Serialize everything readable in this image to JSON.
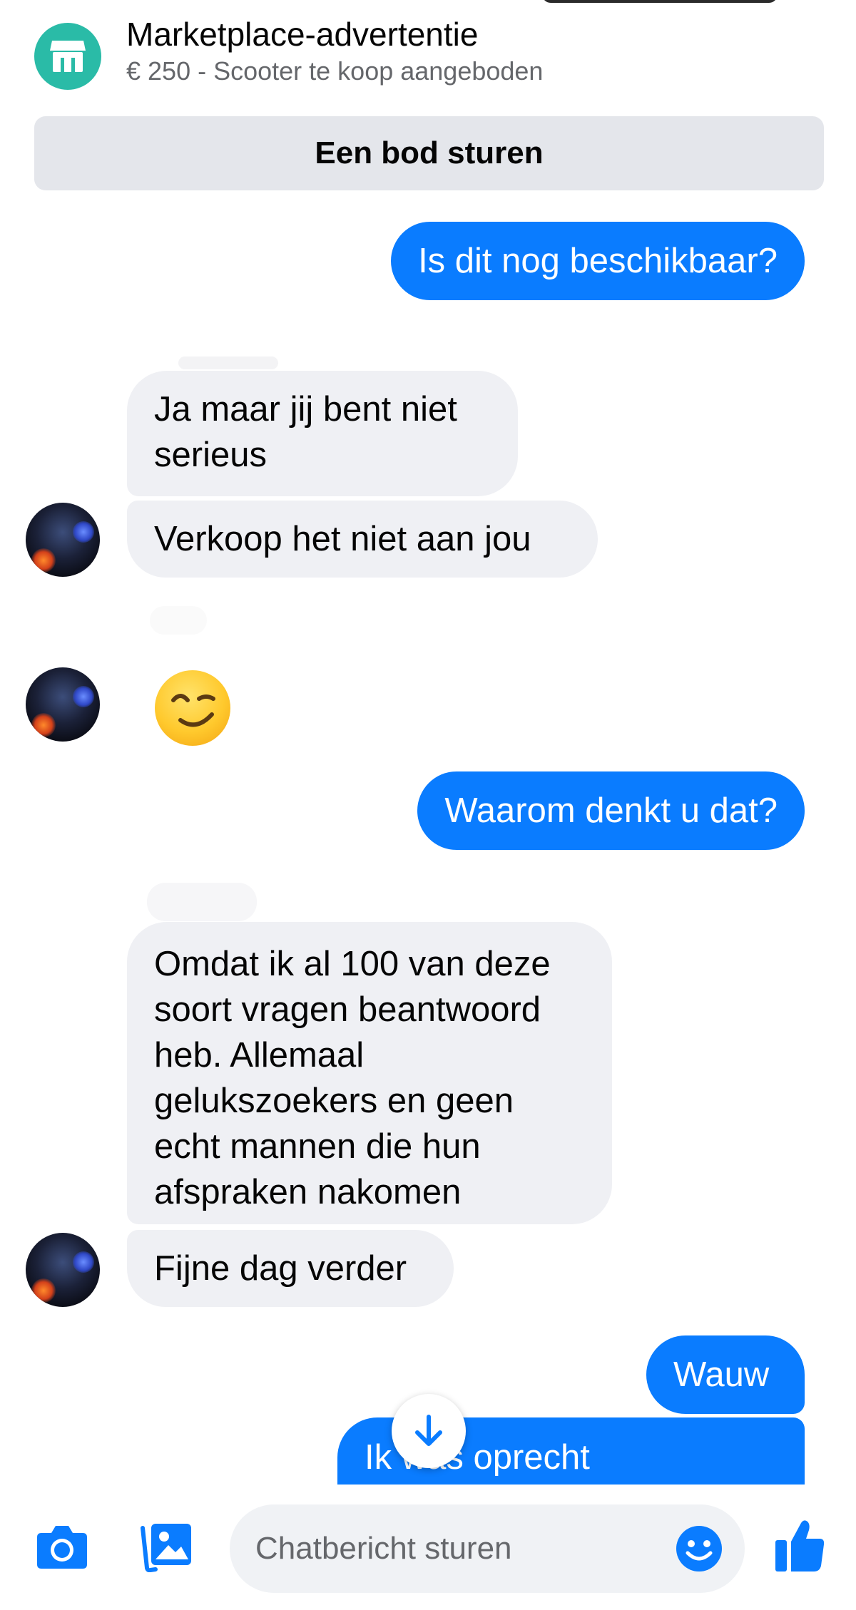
{
  "listing": {
    "title": "Marketplace-advertentie",
    "subtitle": "€ 250 - Scooter te koop aangeboden",
    "offer_button": "Een bod sturen"
  },
  "messages": [
    {
      "from": "me",
      "text": "Is dit nog beschikbaar?"
    },
    {
      "from": "seller",
      "text": "Ja maar jij bent niet\nserieus"
    },
    {
      "from": "seller",
      "text": "Verkoop het niet aan jou"
    },
    {
      "from": "seller",
      "text": "😉",
      "type": "emoji"
    },
    {
      "from": "me",
      "text": "Waarom denkt u dat?"
    },
    {
      "from": "seller",
      "text": "Omdat ik al 100 van deze\nsoort vragen beantwoord\nheb. Allemaal\ngelukszoekers en geen\necht mannen die hun\nafspraken nakomen"
    },
    {
      "from": "seller",
      "text": "Fijne dag verder"
    },
    {
      "from": "me",
      "text": "Wauw"
    },
    {
      "from": "me",
      "text": "Ik was oprecht"
    }
  ],
  "composer": {
    "placeholder": "Chatbericht sturen"
  },
  "icons": {
    "store": "store-icon",
    "camera": "camera-icon",
    "gallery": "gallery-icon",
    "emoji": "emoji-icon",
    "like": "thumbs-up-icon",
    "scroll": "arrow-down-icon"
  },
  "colors": {
    "outgoing_bubble": "#0a7cff",
    "incoming_bubble": "#eff0f4",
    "accent": "#0a7cff",
    "marketplace_teal": "#2abba7"
  }
}
